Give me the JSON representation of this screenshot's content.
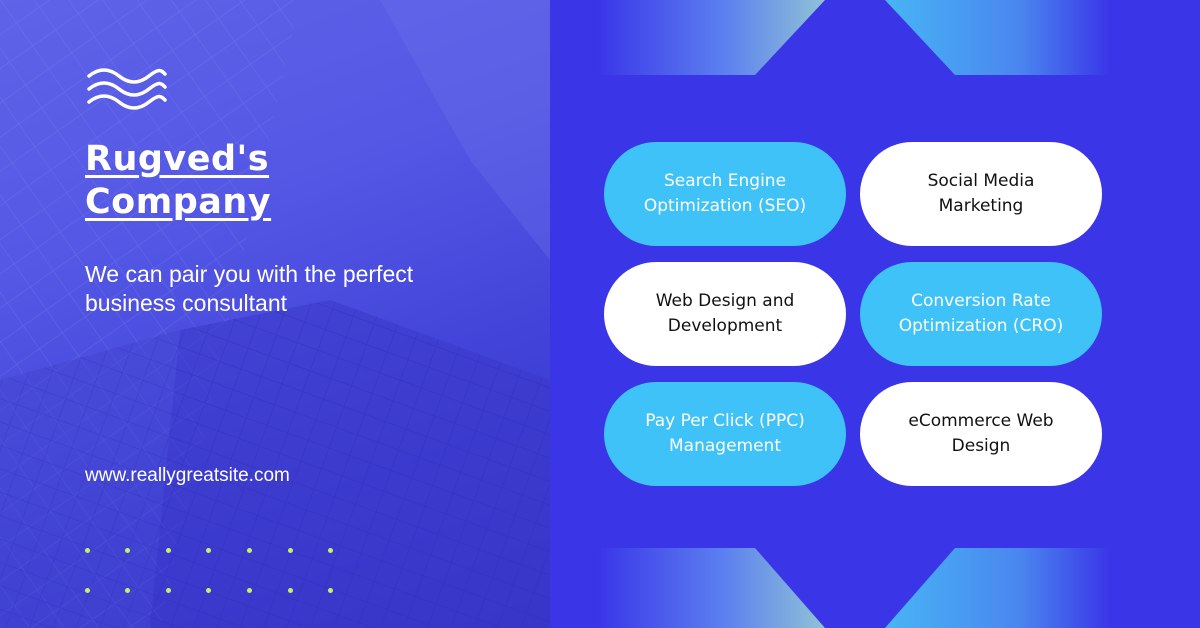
{
  "brand": {
    "title_line1": "Rugved's",
    "title_line2": "Company",
    "tagline": "We can pair you with the perfect business consultant",
    "website": "www.reallygreatsite.com"
  },
  "services": [
    {
      "label": "Search Engine Optimization (SEO)",
      "style": "blue"
    },
    {
      "label": "Social Media Marketing",
      "style": "white"
    },
    {
      "label": "Web Design and Development",
      "style": "white"
    },
    {
      "label": "Conversion Rate Optimization (CRO)",
      "style": "blue"
    },
    {
      "label": "Pay Per Click (PPC) Management",
      "style": "blue"
    },
    {
      "label": "eCommerce Web Design",
      "style": "white"
    }
  ],
  "colors": {
    "background": "#3a36e8",
    "accent_blue": "#3ec2f7",
    "dot_accent": "#c6f069"
  },
  "icons": [
    "waves-logo-icon"
  ]
}
